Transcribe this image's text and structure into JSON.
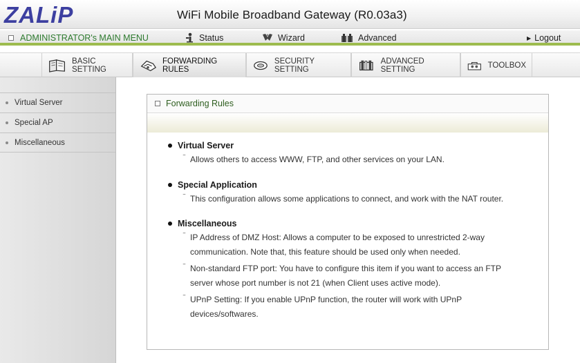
{
  "header": {
    "logo_text": "ZALiP",
    "title": "WiFi Mobile Broadband Gateway (R0.03a3)"
  },
  "adminbar": {
    "admin_menu": "ADMINISTRATOR's MAIN MENU",
    "status": "Status",
    "wizard": "Wizard",
    "advanced": "Advanced",
    "logout": "Logout"
  },
  "tabs": [
    {
      "label": "BASIC SETTING",
      "icon": "book-icon"
    },
    {
      "label": "FORWARDING RULES",
      "icon": "forward-icon"
    },
    {
      "label": "SECURITY SETTING",
      "icon": "lock-icon"
    },
    {
      "label": "ADVANCED SETTING",
      "icon": "advanced-icon"
    },
    {
      "label": "TOOLBOX",
      "icon": "toolbox-icon"
    }
  ],
  "sidebar": {
    "items": [
      {
        "label": "Virtual Server"
      },
      {
        "label": "Special AP"
      },
      {
        "label": "Miscellaneous"
      }
    ]
  },
  "panel": {
    "title": "Forwarding Rules",
    "sections": [
      {
        "title": "Virtual Server",
        "items": [
          "Allows others to access WWW, FTP, and other services on your LAN."
        ]
      },
      {
        "title": "Special Application",
        "items": [
          "This configuration allows some applications to connect, and work with the NAT router."
        ]
      },
      {
        "title": "Miscellaneous",
        "items": [
          "IP Address of DMZ Host: Allows a computer to be exposed to unrestricted 2-way communication. Note that, this feature should be used only when needed.",
          "Non-standard FTP port: You have to configure this item if you want to access an FTP server whose port number is not 21 (when Client uses active mode).",
          "UPnP Setting: If you enable UPnP function, the router will work with UPnP devices/softwares."
        ]
      }
    ]
  },
  "colors": {
    "logo": "#3c3fa0",
    "admin_green": "#2d7a2e",
    "accent_bar": "#9dbb4e"
  }
}
